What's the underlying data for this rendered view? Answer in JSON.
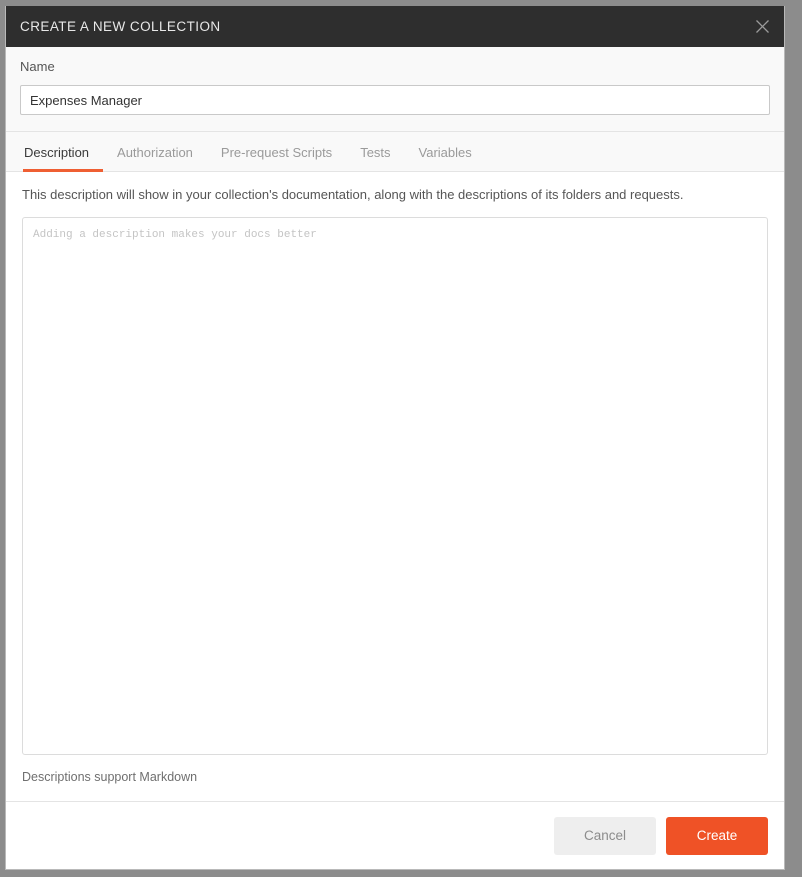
{
  "window": {
    "backdrop_color": "#8c8c8c"
  },
  "header": {
    "title": "CREATE A NEW COLLECTION",
    "background_color": "#2e2e2e",
    "close_icon": "close-icon"
  },
  "name_section": {
    "label": "Name",
    "value": "Expenses Manager",
    "placeholder": "Name"
  },
  "tabs": {
    "active_index": 0,
    "accent_color": "#ef5f33",
    "items": [
      {
        "label": "Description"
      },
      {
        "label": "Authorization"
      },
      {
        "label": "Pre-request Scripts"
      },
      {
        "label": "Tests"
      },
      {
        "label": "Variables"
      }
    ]
  },
  "description_panel": {
    "helper_text": "This description will show in your collection's documentation, along with the descriptions of its folders and requests.",
    "textarea_value": "",
    "textarea_placeholder": "Adding a description makes your docs better",
    "markdown_note": "Descriptions support Markdown"
  },
  "footer": {
    "cancel_label": "Cancel",
    "create_label": "Create",
    "create_color": "#ef5226",
    "cancel_color": "#eeeeee"
  }
}
